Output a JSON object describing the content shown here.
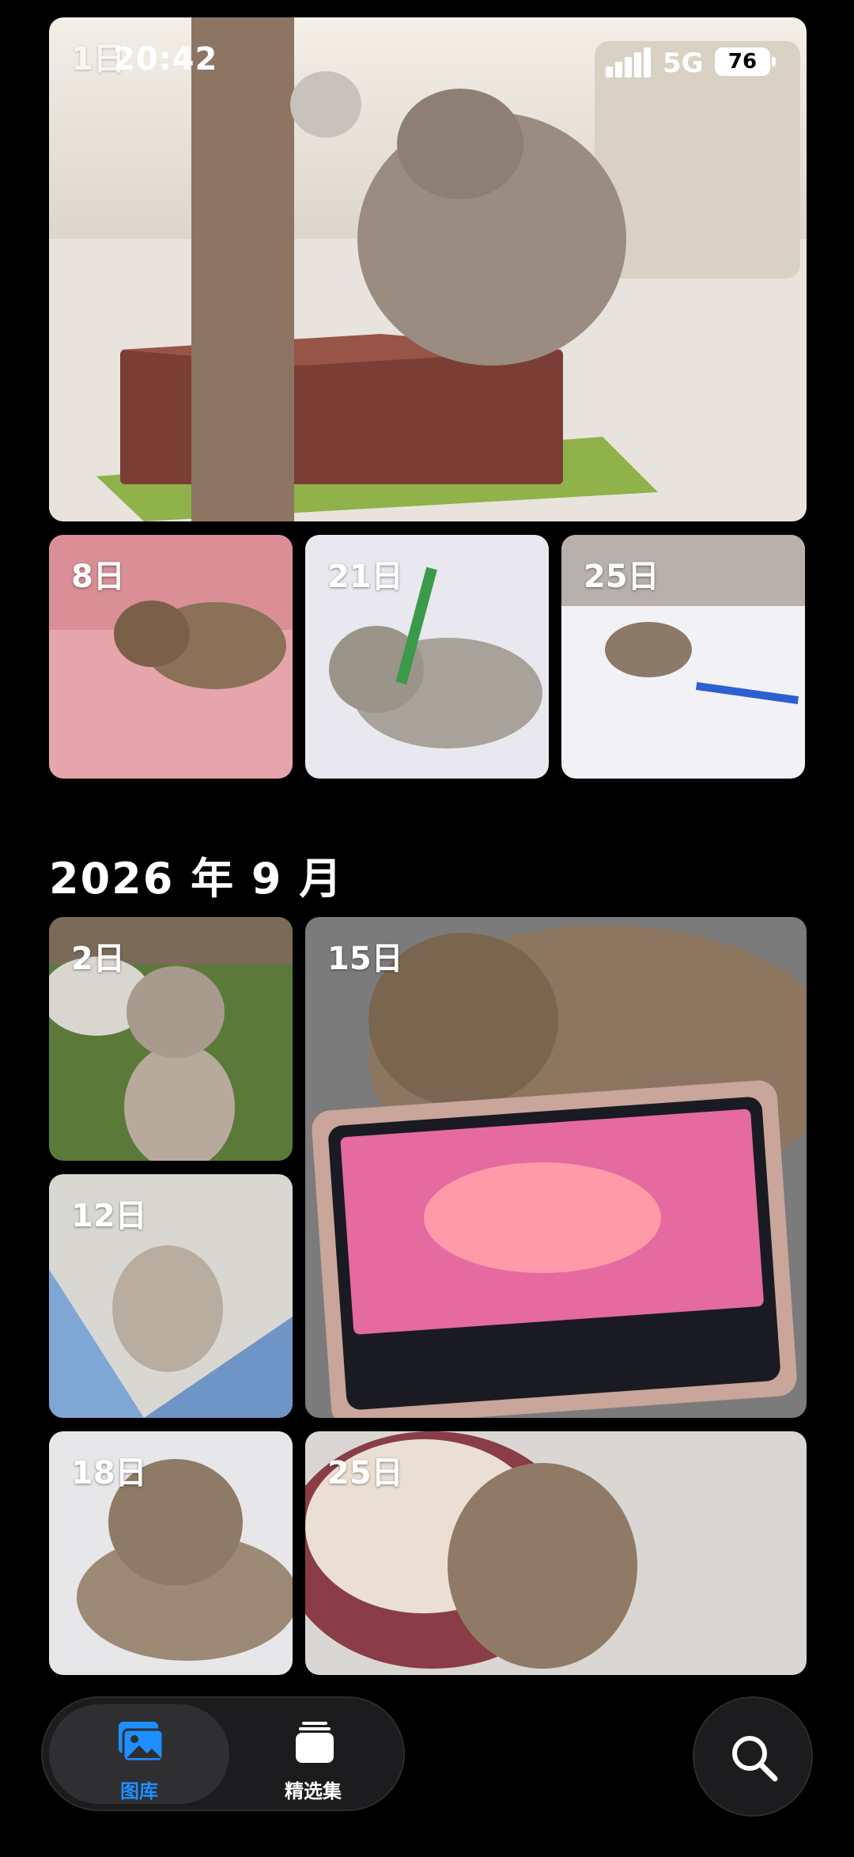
{
  "status_bar": {
    "time": "20:42",
    "network": "5G",
    "battery": "76"
  },
  "photos_top": {
    "hero_label": "1日",
    "row": [
      {
        "label": "8日"
      },
      {
        "label": "21日"
      },
      {
        "label": "25日"
      }
    ]
  },
  "section": {
    "title": "2026 年 9 月",
    "photos": [
      {
        "label": "2日"
      },
      {
        "label": "15日"
      },
      {
        "label": "12日"
      },
      {
        "label": "18日"
      },
      {
        "label": "25日"
      }
    ]
  },
  "tab_bar": {
    "library_label": "图库",
    "collections_label": "精选集"
  },
  "colors": {
    "accent": "#1f8fff",
    "background": "#000000"
  }
}
